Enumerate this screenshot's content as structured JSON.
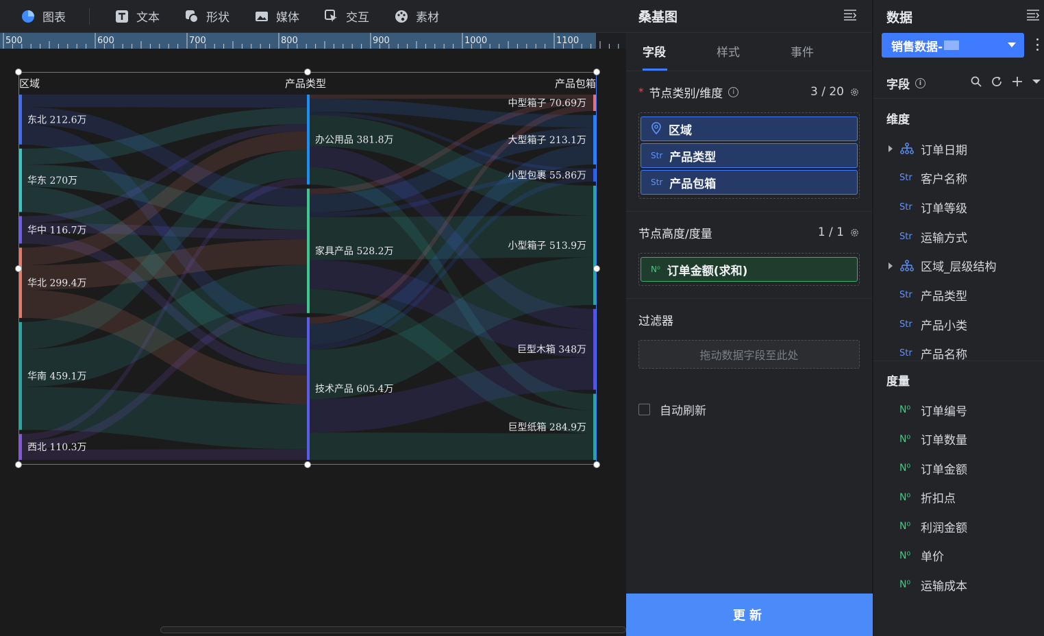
{
  "toolbar": {
    "items": [
      {
        "label": "图表",
        "icon": "pie-chart-icon"
      },
      {
        "label": "文本",
        "icon": "text-icon"
      },
      {
        "label": "形状",
        "icon": "shape-icon"
      },
      {
        "label": "媒体",
        "icon": "image-icon"
      },
      {
        "label": "交互",
        "icon": "cursor-icon"
      },
      {
        "label": "素材",
        "icon": "palette-icon"
      }
    ]
  },
  "ruler": {
    "labels": [
      "500",
      "600",
      "700",
      "800",
      "900",
      "1000",
      "1100"
    ]
  },
  "chart_data": {
    "type": "sankey",
    "columns": [
      "区域",
      "产品类型",
      "产品包箱"
    ],
    "nodes": {
      "区域": [
        {
          "name": "东北",
          "value": "212.6万",
          "num": 212.6,
          "color": "#3f6cf0"
        },
        {
          "name": "华东",
          "value": "270万",
          "num": 270,
          "color": "#3ec3c3"
        },
        {
          "name": "华中",
          "value": "116.7万",
          "num": 116.7,
          "color": "#6f5ce6"
        },
        {
          "name": "华北",
          "value": "299.4万",
          "num": 299.4,
          "color": "#e07b6b"
        },
        {
          "name": "华南",
          "value": "459.1万",
          "num": 459.1,
          "color": "#2aa5a0"
        },
        {
          "name": "西北",
          "value": "110.3万",
          "num": 110.3,
          "color": "#8257d8"
        }
      ],
      "产品类型": [
        {
          "name": "办公用品",
          "value": "381.8万",
          "num": 381.8,
          "color": "#1e8ff0"
        },
        {
          "name": "家具产品",
          "value": "528.2万",
          "num": 528.2,
          "color": "#3fc78f"
        },
        {
          "name": "技术产品",
          "value": "605.4万",
          "num": 605.4,
          "color": "#5b5ce8"
        }
      ],
      "产品包箱": [
        {
          "name": "中型箱子",
          "value": "70.69万",
          "num": 70.69,
          "color": "#e0737a"
        },
        {
          "name": "大型箱子",
          "value": "213.1万",
          "num": 213.1,
          "color": "#2f7ef0"
        },
        {
          "name": "小型包裹",
          "value": "55.86万",
          "num": 55.86,
          "color": "#2f5fe8"
        },
        {
          "name": "小型箱子",
          "value": "513.9万",
          "num": 513.9,
          "color": "#2aa59c"
        },
        {
          "name": "巨型木箱",
          "value": "348万",
          "num": 348,
          "color": "#5a4fe0"
        },
        {
          "name": "巨型纸箱",
          "value": "284.9万",
          "num": 284.9,
          "color": "#2aa59c"
        }
      ]
    }
  },
  "props": {
    "title": "桑基图",
    "tabs": [
      "字段",
      "样式",
      "事件"
    ],
    "dimension": {
      "title": "节点类别/维度",
      "count": "3 / 20",
      "fields": [
        {
          "tag": "⌖",
          "label": "区域"
        },
        {
          "tag": "Str",
          "label": "产品类型"
        },
        {
          "tag": "Str",
          "label": "产品包箱"
        }
      ]
    },
    "measure": {
      "title": "节点高度/度量",
      "count": "1 / 1",
      "fields": [
        {
          "tag": "N⁰",
          "label": "订单金额(求和)"
        }
      ]
    },
    "filter": {
      "title": "过滤器",
      "placeholder": "拖动数据字段至此处"
    },
    "auto_refresh": "自动刷新",
    "update": "更新"
  },
  "data": {
    "title": "数据",
    "dataset": "销售数据-",
    "fields_title": "字段",
    "dim_title": "维度",
    "dimensions": [
      {
        "tag": "hier",
        "label": "订单日期",
        "expandable": true
      },
      {
        "tag": "Str",
        "label": "客户名称"
      },
      {
        "tag": "Str",
        "label": "订单等级"
      },
      {
        "tag": "Str",
        "label": "运输方式"
      },
      {
        "tag": "hier",
        "label": "区域_层级结构",
        "expandable": true
      },
      {
        "tag": "Str",
        "label": "产品类型"
      },
      {
        "tag": "Str",
        "label": "产品小类"
      },
      {
        "tag": "Str",
        "label": "产品名称"
      }
    ],
    "meas_title": "度量",
    "measures": [
      {
        "tag": "N⁰",
        "label": "订单编号"
      },
      {
        "tag": "N⁰",
        "label": "订单数量"
      },
      {
        "tag": "N⁰",
        "label": "订单金额"
      },
      {
        "tag": "N⁰",
        "label": "折扣点"
      },
      {
        "tag": "N⁰",
        "label": "利润金额"
      },
      {
        "tag": "N⁰",
        "label": "单价"
      },
      {
        "tag": "N⁰",
        "label": "运输成本"
      }
    ]
  }
}
